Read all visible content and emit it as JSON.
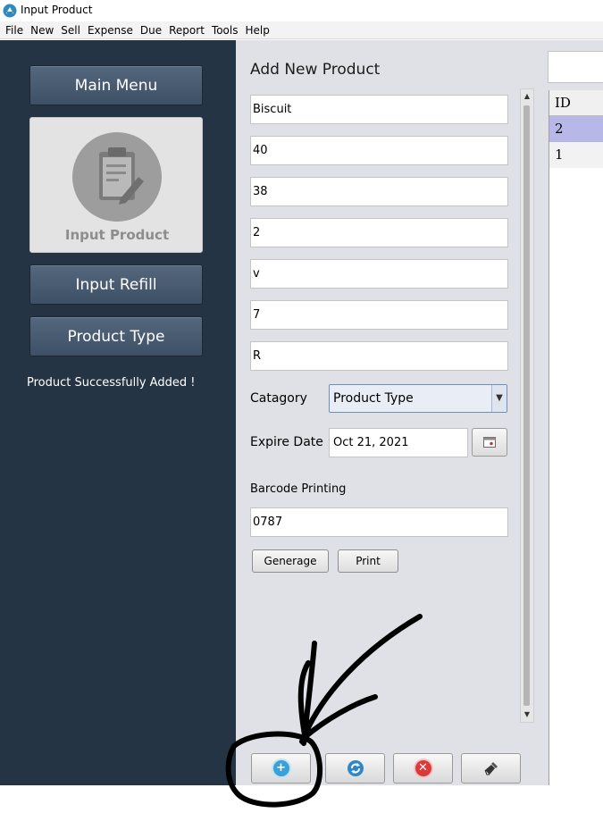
{
  "window": {
    "title": "Input Product"
  },
  "menubar": [
    "File",
    "New",
    "Sell",
    "Expense",
    "Due",
    "Report",
    "Tools",
    "Help"
  ],
  "sidebar": {
    "main_menu": "Main Menu",
    "input_product": "Input Product",
    "input_refill": "Input Refill",
    "product_type": "Product Type",
    "status": "Product Successfully Added !"
  },
  "form": {
    "heading": "Add New Product",
    "fields": [
      "Biscuit",
      "40",
      "38",
      "2",
      "v",
      "7",
      "R"
    ],
    "category_label": "Catagory",
    "category_value": "Product Type",
    "expire_label": "Expire Date",
    "expire_value": "Oct 21, 2021",
    "barcode_label": "Barcode Printing",
    "barcode_value": "0787",
    "generate_btn": "Generage",
    "print_btn": "Print"
  },
  "table": {
    "header": "ID",
    "rows": [
      "2",
      "1"
    ],
    "selected_row_color": "#b8b8e8"
  },
  "actions": {
    "add_icon": "plus-circle-icon",
    "refresh_icon": "refresh-icon",
    "delete_icon": "close-circle-icon",
    "clear_icon": "broom-icon"
  },
  "colors": {
    "sidebar": "#253445",
    "panel": "#dfe1e6",
    "annotation": "#000000"
  }
}
